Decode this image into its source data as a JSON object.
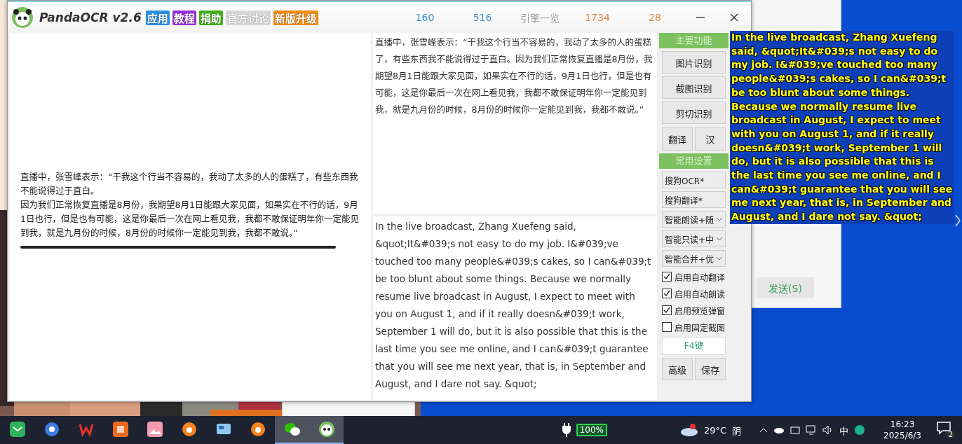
{
  "app": {
    "title": "PandaOCR v2.6",
    "badges": [
      {
        "label": "应用",
        "color": "#2b8fe0"
      },
      {
        "label": "教程",
        "color": "#9b30d9"
      },
      {
        "label": "捐助",
        "color": "#3fae1a"
      },
      {
        "label": "官方讨论",
        "color": "#d8d8d8"
      },
      {
        "label": "新版升级",
        "color": "#f08a10"
      }
    ],
    "stats": [
      {
        "value": "160",
        "color": "#3a8fd0"
      },
      {
        "value": "516",
        "color": "#3a8fd0"
      },
      {
        "value": "引擎一览",
        "color": "#a0a0a0"
      },
      {
        "value": "1734",
        "color": "#e08a40"
      },
      {
        "value": "28",
        "color": "#e08a40"
      }
    ]
  },
  "source_paragraphs": [
    "直播中，张雪峰表示：“干我这个行当不容易的，我动了太多的人的蛋糕了，有些东西我不能说得过于直白。",
    "因为我们正常恢复直播是8月份，我期望8月1日能跟大家见面，如果实在不行的话，9月1日也行，但是也有可能，这是你最后一次在网上看见我，我都不敢保证明年你一定能见到我，就是九月份的时候，8月份的时候你一定能见到我，我都不敢说。”"
  ],
  "ocr_text": "直播中，张雪峰表示：“干我这个行当不容易的，我动了太多的人的蛋糕了，有些东西我不能说得过于直白。因为我们正常恢复直播是8月份，我期望8月1日能跟大家见面，如果实在不行的话，9月1日也行，但是也有可能，这是你最后一次在网上看见我，我都不敢保证明年你一定能见到我，就是九月份的时候，8月份的时候你一定能见到我，我都不敢说。”",
  "translation": "In the live broadcast, Zhang Xuefeng said, &quot;It&#039;s not easy to do my job. I&#039;ve touched too many people&#039;s cakes, so I can&#039;t be too blunt about some things. Because we normally resume live broadcast in August, I expect to meet with you on August 1, and if it really doesn&#039;t work, September 1 will do, but it is also possible that this is the last time you see me online, and I can&#039;t guarantee that you will see me next year, that is, in September and August, and I dare not say. &quot;",
  "main_functions": {
    "header": "主要功能",
    "buttons": [
      "图片识别",
      "截图识别",
      "剪切识别"
    ],
    "small_buttons": [
      "翻译",
      "汉"
    ]
  },
  "settings": {
    "header": "常用设置",
    "selects": [
      "搜狗OCR*",
      "搜狗翻译*",
      "智能朗读+随",
      "智能只读+中",
      "智能合并+优"
    ],
    "checkboxes": [
      {
        "label": "启用自动翻译",
        "checked": true
      },
      {
        "label": "启用自动朗读",
        "checked": true
      },
      {
        "label": "启用预览弹窗",
        "checked": true
      },
      {
        "label": "启用固定截图",
        "checked": false
      }
    ],
    "hotkey": "F4键",
    "buttons": [
      "高级",
      "保存"
    ]
  },
  "overlay_text": "In the live broadcast, Zhang Xuefeng said, &quot;It&#039;s not easy to do my job. I&#039;ve touched too many people&#039;s cakes, so I can&#039;t be too blunt about some things. Because we normally resume live broadcast in August, I expect to meet with you on August 1, and if it really doesn&#039;t work, September 1 will do, but it is also possible that this is the last time you see me online, and I can&#039;t guarantee that you will see me next year, that is, in September and August, and I dare not say. &quot;",
  "background_window": {
    "send_button": "发送(S)"
  },
  "taskbar": {
    "apps": [
      {
        "kind": "chat",
        "selected": false
      },
      {
        "kind": "browser",
        "selected": false
      },
      {
        "kind": "wps",
        "selected": false
      },
      {
        "kind": "office",
        "selected": false
      },
      {
        "kind": "gallery",
        "selected": false
      },
      {
        "kind": "orange",
        "selected": false
      },
      {
        "kind": "screen",
        "selected": false
      },
      {
        "kind": "orange",
        "selected": false
      },
      {
        "kind": "wechat",
        "selected": true
      },
      {
        "kind": "panda",
        "selected": true
      }
    ],
    "battery": "100%",
    "temperature": "29°C",
    "weather": "阴",
    "ime": "中",
    "time": "16:23",
    "date": "2025/6/3",
    "notifications": "2"
  }
}
